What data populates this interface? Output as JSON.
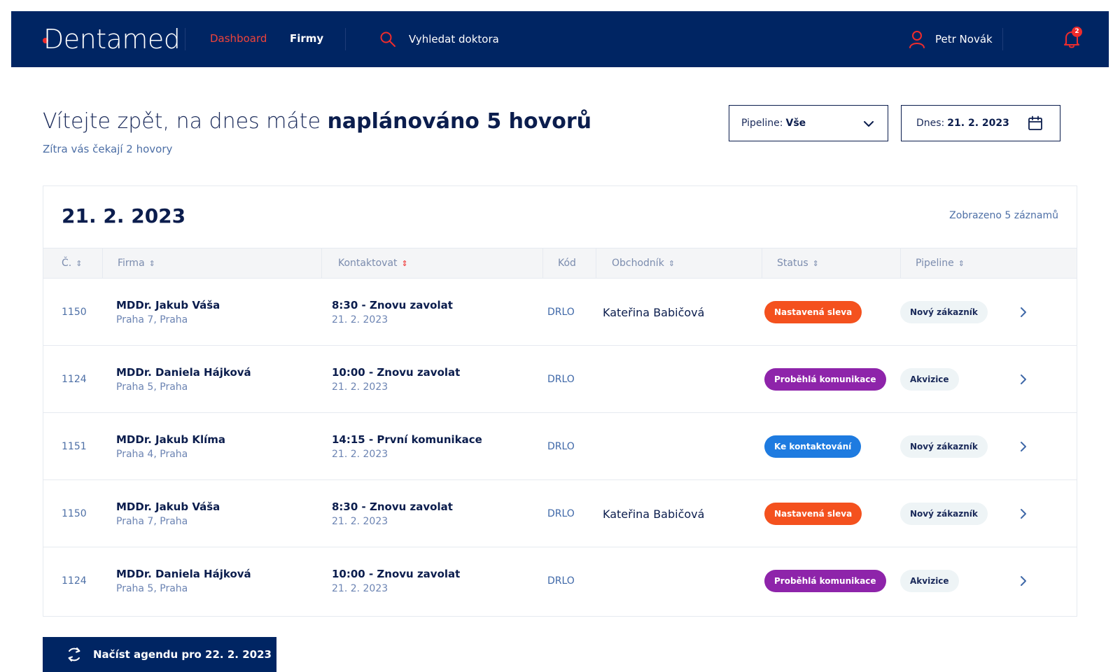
{
  "nav": {
    "logo": "Dentamed",
    "links": [
      {
        "label": "Dashboard",
        "active": true
      },
      {
        "label": "Firmy",
        "active": false
      }
    ],
    "search_label": "Vyhledat doktora",
    "user_name": "Petr Novák",
    "notifications_count": "2"
  },
  "header": {
    "welcome_prefix": "Vítejte zpět, na dnes máte",
    "welcome_bold": "naplánováno 5 hovorů",
    "subtitle": "Zítra vás čekají 2 hovory",
    "pipeline_label": "Pipeline:",
    "pipeline_value": "Vše",
    "date_label": "Dnes:",
    "date_value": "21. 2. 2023"
  },
  "agenda": {
    "title": "21. 2. 2023",
    "count_text": "Zobrazeno 5 záznamů",
    "columns": [
      "Č.",
      "Firma",
      "Kontaktovat",
      "Kód",
      "Obchodník",
      "Status",
      "Pipeline"
    ],
    "rows": [
      {
        "num": "1150",
        "firm": "MDDr. Jakub Váša",
        "address": "Praha 7, Praha",
        "contact": "8:30 - Znovu zavolat",
        "contact_date": "21. 2. 2023",
        "code": "DRLO",
        "rep": "Kateřina Babičová",
        "status": "Nastavená sleva",
        "status_color": "#f4511e",
        "pipeline": "Nový zákazník"
      },
      {
        "num": "1124",
        "firm": "MDDr. Daniela Hájková",
        "address": "Praha 5, Praha",
        "contact": "10:00 - Znovu zavolat",
        "contact_date": "21. 2. 2023",
        "code": "DRLO",
        "rep": "",
        "status": "Proběhlá komunikace",
        "status_color": "#8e24aa",
        "pipeline": "Akvizice"
      },
      {
        "num": "1151",
        "firm": "MDDr. Jakub Klíma",
        "address": "Praha 4, Praha",
        "contact": "14:15 - První komunikace",
        "contact_date": "21. 2. 2023",
        "code": "DRLO",
        "rep": "",
        "status": "Ke kontaktování",
        "status_color": "#1e7be0",
        "pipeline": "Nový zákazník"
      },
      {
        "num": "1150",
        "firm": "MDDr. Jakub Váša",
        "address": "Praha 7, Praha",
        "contact": "8:30 - Znovu zavolat",
        "contact_date": "21. 2. 2023",
        "code": "DRLO",
        "rep": "Kateřina Babičová",
        "status": "Nastavená sleva",
        "status_color": "#f4511e",
        "pipeline": "Nový zákazník"
      },
      {
        "num": "1124",
        "firm": "MDDr. Daniela Hájková",
        "address": "Praha 5, Praha",
        "contact": "10:00 - Znovu zavolat",
        "contact_date": "21. 2. 2023",
        "code": "DRLO",
        "rep": "",
        "status": "Proběhlá komunikace",
        "status_color": "#8e24aa",
        "pipeline": "Akvizice"
      }
    ]
  },
  "load_button": {
    "label": "Načíst agendu pro 22. 2. 2023"
  },
  "colors": {
    "navy": "#002563",
    "accent_red": "#ef2c2c",
    "muted_blue": "#4d6fa6"
  }
}
